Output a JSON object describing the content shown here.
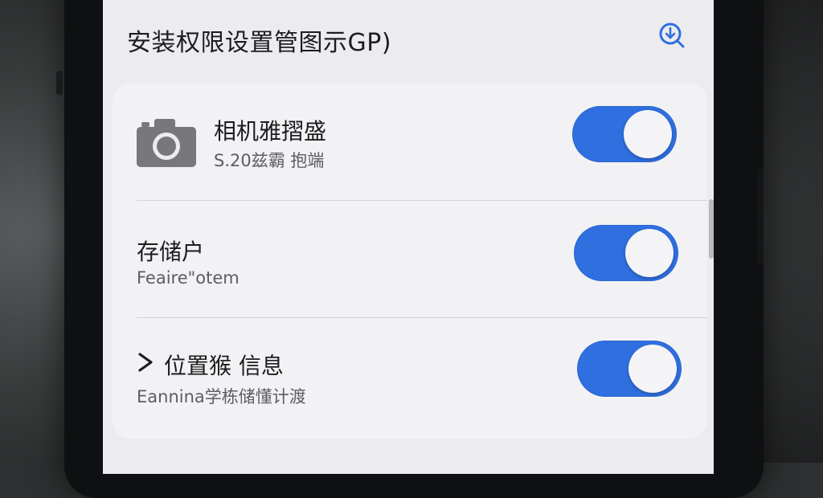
{
  "header": {
    "title": "安装权限设置管图示GP)",
    "action_icon": "download-search-icon"
  },
  "permissions": [
    {
      "title": "相机雅摺盛",
      "subtitle": "S.20兹霸 抱端",
      "icon": "camera-icon",
      "enabled": true
    },
    {
      "title": "存储户",
      "subtitle": "Feaire\"otem",
      "enabled": true
    },
    {
      "title": "位置猴 信息",
      "subtitle": "Eannina学栋储懂计渡",
      "icon": "chevron-right-icon",
      "enabled": true
    }
  ],
  "colors": {
    "accent": "#2f6fe0",
    "screen_bg": "#ececef",
    "card_bg": "#f2f2f4"
  }
}
